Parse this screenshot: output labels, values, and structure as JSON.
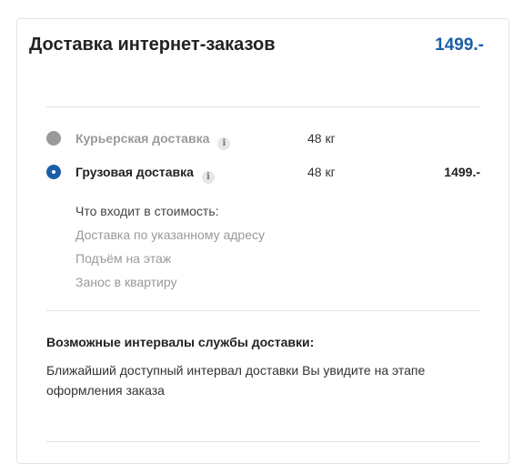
{
  "header": {
    "title": "Доставка интернет-заказов",
    "total": "1499.-"
  },
  "options": [
    {
      "label": "Курьерская доставка",
      "weight": "48 кг",
      "price": "",
      "state": "disabled",
      "info_icon": "info-icon"
    },
    {
      "label": "Грузовая доставка",
      "weight": "48 кг",
      "price": "1499.-",
      "state": "selected",
      "info_icon": "info-icon"
    }
  ],
  "includes": {
    "heading": "Что входит в стоимость:",
    "items": [
      "Доставка по указанному адресу",
      "Подъём на этаж",
      "Занос в квартиру"
    ]
  },
  "intervals": {
    "title": "Возможные интервалы службы доставки:",
    "text": "Ближайший доступный интервал доставки Вы увидите на этапе оформления заказа"
  },
  "colors": {
    "accent": "#1c5fa8",
    "muted": "#9a9a9a",
    "divider": "#e3e3e3"
  }
}
